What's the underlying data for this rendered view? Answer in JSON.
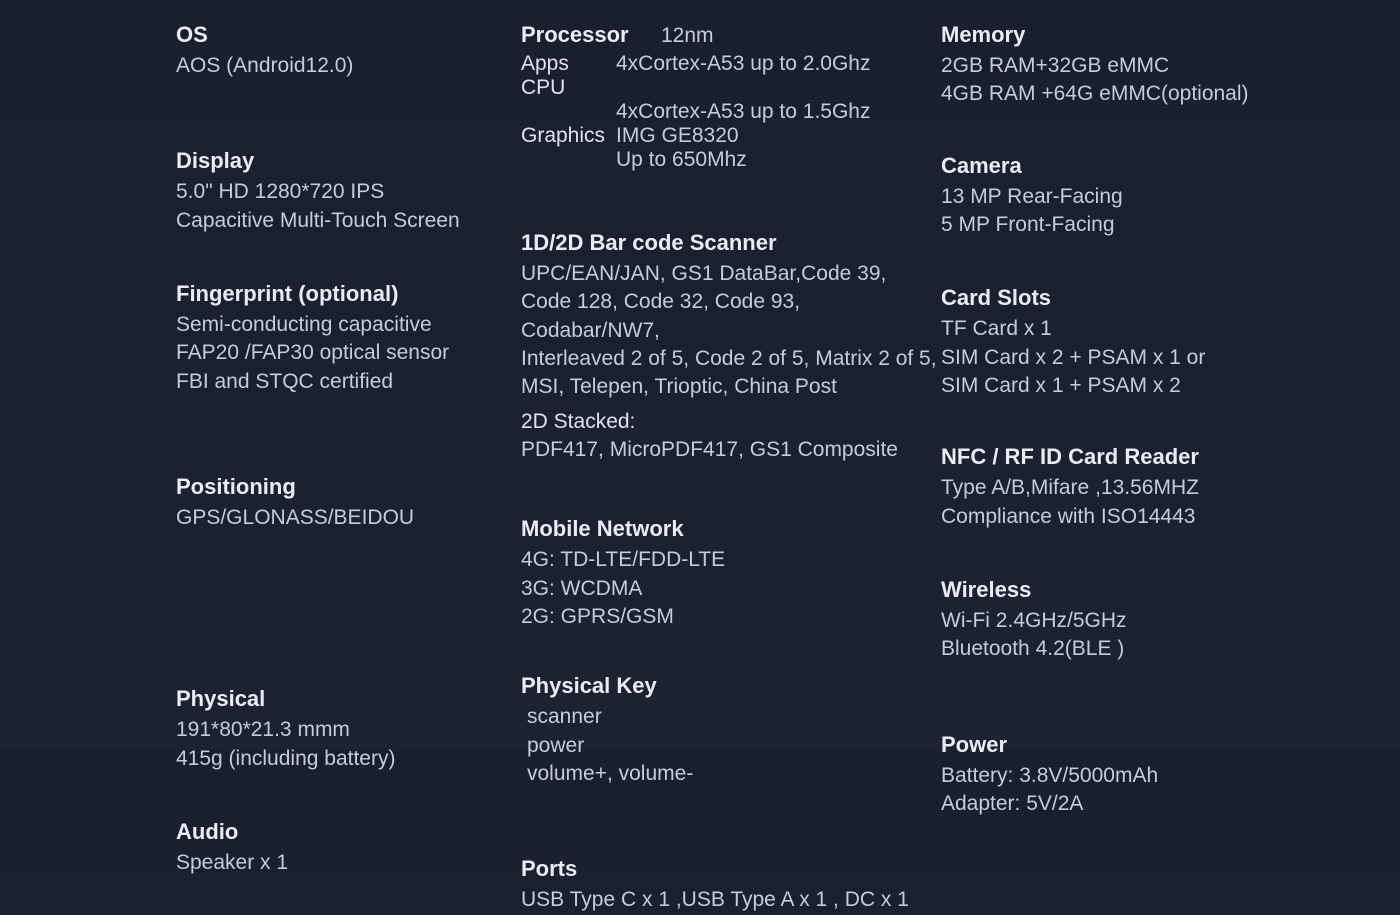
{
  "col1": {
    "os": {
      "title": "OS",
      "lines": [
        "AOS (Android12.0)"
      ]
    },
    "display": {
      "title": "Display",
      "lines": [
        "5.0\" HD 1280*720 IPS",
        "Capacitive Multi-Touch Screen"
      ]
    },
    "fingerprint": {
      "title": "Fingerprint (optional)",
      "lines": [
        "Semi-conducting capacitive",
        "FAP20 /FAP30 optical  sensor",
        "FBI and STQC certified"
      ]
    },
    "positioning": {
      "title": "Positioning",
      "lines": [
        "GPS/GLONASS/BEIDOU"
      ]
    },
    "physical": {
      "title": "Physical",
      "lines": [
        "191*80*21.3 mmm",
        "415g (including battery)"
      ]
    },
    "audio": {
      "title": "Audio",
      "lines": [
        "Speaker x 1"
      ]
    }
  },
  "col2": {
    "processor": {
      "title": "Processor",
      "nm": "12nm",
      "appsKey": "Apps CPU",
      "appsLines": [
        "4xCortex-A53 up to 2.0Ghz",
        "4xCortex-A53 up to 1.5Ghz"
      ],
      "graphicsKey": "Graphics",
      "graphicsLines": [
        "IMG GE8320",
        "Up to 650Mhz"
      ]
    },
    "barcode": {
      "title": "1D/2D Bar code Scanner",
      "lines": [
        "UPC/EAN/JAN, GS1 DataBar,Code 39,",
        "Code 128, Code 32, Code 93, Codabar/NW7,",
        "Interleaved 2 of 5, Code 2 of 5, Matrix 2 of 5,",
        "MSI, Telepen, Trioptic, China Post"
      ],
      "stackTitle": "2D Stacked:",
      "stackLines": [
        "PDF417, MicroPDF417, GS1 Composite"
      ]
    },
    "network": {
      "title": "Mobile Network",
      "lines": [
        "4G: TD-LTE/FDD-LTE",
        "3G: WCDMA",
        "2G: GPRS/GSM"
      ]
    },
    "keys": {
      "title": "Physical Key",
      "lines": [
        "scanner",
        "power",
        "volume+, volume-"
      ]
    },
    "ports": {
      "title": "Ports",
      "lines": [
        "USB Type C x 1  ,USB Type A x 1 , DC x 1"
      ]
    }
  },
  "col3": {
    "memory": {
      "title": "Memory",
      "lines": [
        "2GB RAM+32GB eMMC",
        "4GB RAM +64G eMMC(optional)"
      ]
    },
    "camera": {
      "title": "Camera",
      "lines": [
        "13 MP Rear-Facing",
        "5 MP Front-Facing"
      ]
    },
    "slots": {
      "title": "Card Slots",
      "lines": [
        "TF Card x 1",
        "SIM Card x 2 + PSAM x 1 or",
        "SIM Card x 1 + PSAM x 2"
      ]
    },
    "nfc": {
      "title": "NFC / RF ID   Card Reader",
      "lines": [
        "Type A/B,Mifare ,13.56MHZ",
        "Compliance with ISO14443"
      ]
    },
    "wireless": {
      "title": "Wireless",
      "lines": [
        "Wi-Fi 2.4GHz/5GHz",
        "Bluetooth 4.2(BLE )"
      ]
    },
    "power": {
      "title": "Power",
      "lines": [
        "Battery: 3.8V/5000mAh",
        "Adapter: 5V/2A"
      ]
    }
  }
}
